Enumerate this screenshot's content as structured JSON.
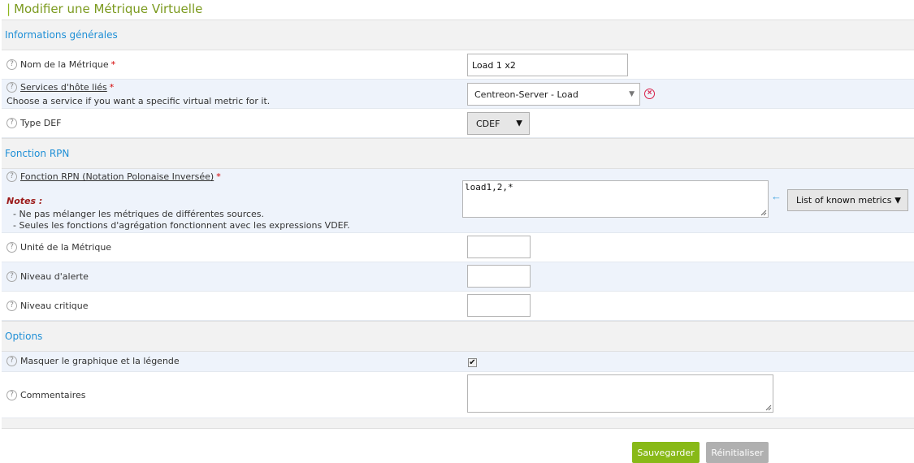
{
  "page": {
    "title": "Modifier une Métrique Virtuelle"
  },
  "sections": {
    "general": "Informations générales",
    "rpn": "Fonction RPN",
    "options": "Options"
  },
  "fields": {
    "name": {
      "label": "Nom de la Métrique",
      "required": "*",
      "value": "Load 1 x2"
    },
    "services": {
      "label": "Services d'hôte liés",
      "required": "*",
      "hint": "Choose a service if you want a specific virtual metric for it.",
      "value": "Centreon-Server - Load"
    },
    "def_type": {
      "label": "Type DEF",
      "value": "CDEF"
    },
    "rpn": {
      "label": "Fonction RPN (Notation Polonaise Inversée)",
      "required": "*",
      "value": "load1,2,*",
      "notes_title": "Notes :",
      "notes": [
        "- Ne pas mélanger les métriques de différentes sources.",
        "- Seules les fonctions d'agrégation fonctionnent avec les expressions VDEF."
      ],
      "known_metrics": "List of known metrics"
    },
    "unit": {
      "label": "Unité de la Métrique",
      "value": ""
    },
    "warning": {
      "label": "Niveau d'alerte",
      "value": ""
    },
    "critical": {
      "label": "Niveau critique",
      "value": ""
    },
    "hide": {
      "label": "Masquer le graphique et la légende",
      "checked": true
    },
    "comments": {
      "label": "Commentaires",
      "value": ""
    }
  },
  "help_glyph": "?",
  "buttons": {
    "save": "Sauvegarder",
    "reset": "Réinitialiser"
  },
  "icons": {
    "help": "help-circle-icon",
    "clear": "clear-x-circle-icon",
    "arrow": "arrow-left-icon",
    "check": "checkmark-icon"
  },
  "colors": {
    "title": "#7b9a1e",
    "section": "#1f8fd6",
    "save": "#88b917",
    "reset": "#b0b0b0",
    "required": "#d40000",
    "clear": "#d8204a"
  }
}
